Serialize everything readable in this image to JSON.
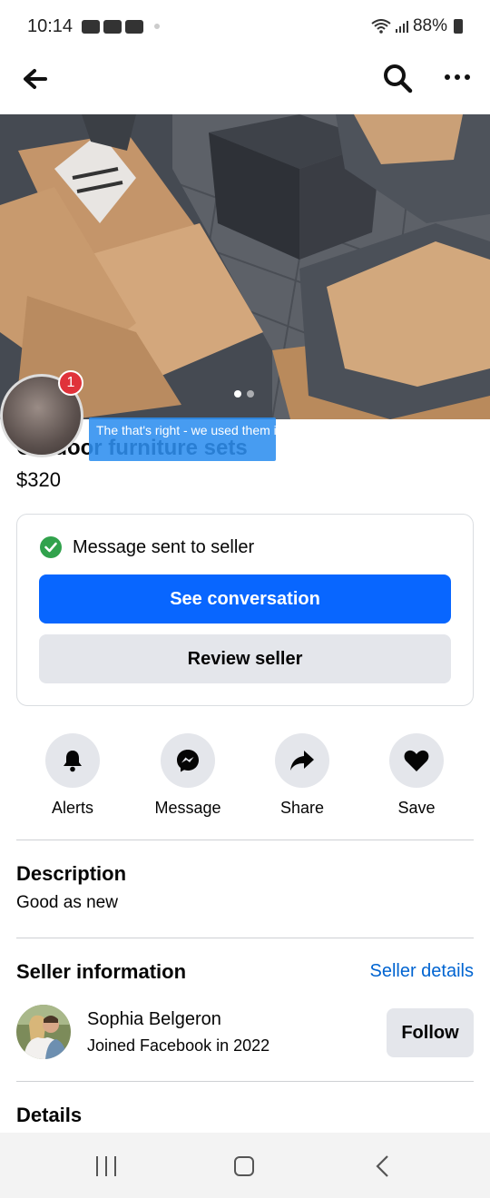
{
  "status_bar": {
    "time": "10:14",
    "battery": "88%"
  },
  "top_bar": {
    "back_icon": "arrow-left-icon",
    "search_icon": "search-icon",
    "more_icon": "more-horizontal-icon"
  },
  "listing": {
    "title": "Outdoor furniture sets",
    "price": "$320",
    "photo_count": 2,
    "active_photo": 1
  },
  "chat_head": {
    "badge_count": "1",
    "preview": "The that's right - we used them in our backyard and c..."
  },
  "message_card": {
    "status": "Message sent to seller",
    "primary_button": "See conversation",
    "secondary_button": "Review seller"
  },
  "actions": [
    {
      "label": "Alerts",
      "icon": "bell-icon"
    },
    {
      "label": "Message",
      "icon": "messenger-icon"
    },
    {
      "label": "Share",
      "icon": "share-arrow-icon"
    },
    {
      "label": "Save",
      "icon": "heart-icon"
    }
  ],
  "description": {
    "heading": "Description",
    "text": "Good as new"
  },
  "seller": {
    "heading": "Seller information",
    "details_link": "Seller details",
    "name": "Sophia Belgeron",
    "joined": "Joined Facebook in 2022",
    "follow_label": "Follow"
  },
  "details": {
    "heading": "Details"
  },
  "colors": {
    "primary_blue": "#0866ff",
    "link_blue": "#0064d1",
    "success_green": "#31a24c",
    "badge_red": "#e0323a",
    "button_gray": "#e4e6eb"
  }
}
